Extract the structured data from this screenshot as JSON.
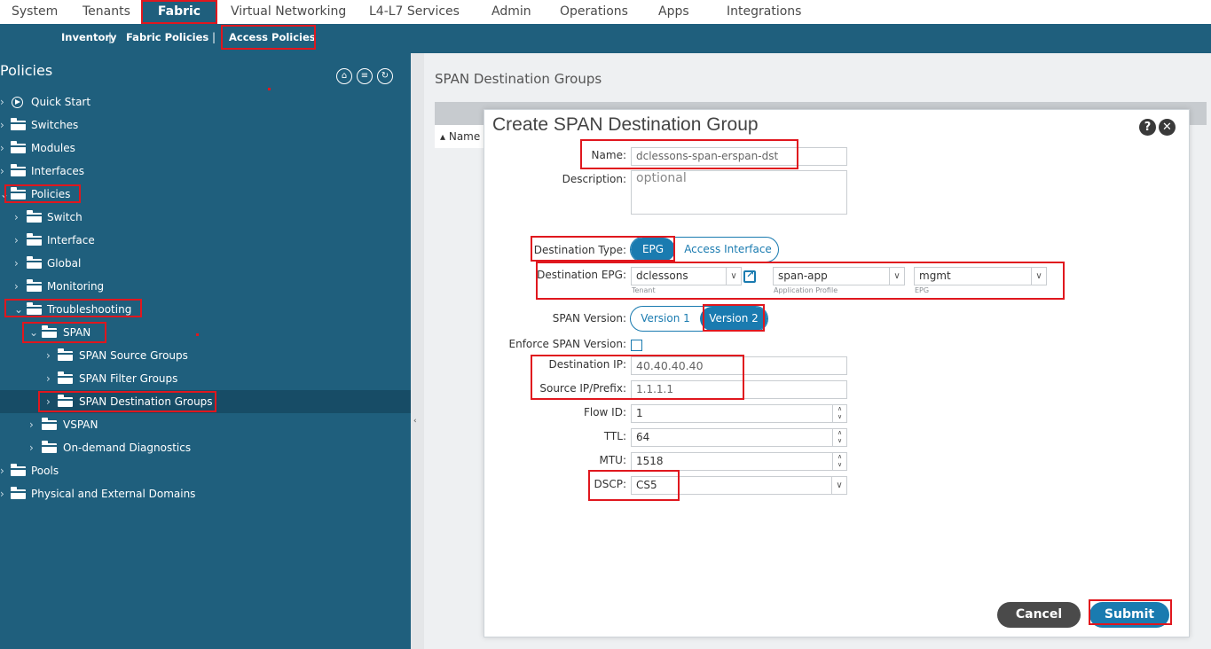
{
  "topnav": {
    "items": [
      "System",
      "Tenants",
      "Fabric",
      "Virtual Networking",
      "L4-L7 Services",
      "Admin",
      "Operations",
      "Apps",
      "Integrations"
    ],
    "active": "Fabric"
  },
  "subnav": {
    "items": [
      "Inventory",
      "Fabric Policies",
      "Access Policies"
    ],
    "separator": "|",
    "active": "Access Policies"
  },
  "sidebar": {
    "title": "Policies",
    "tool_icons": [
      "dashboard-icon",
      "collapse-all-icon",
      "refresh-icon"
    ],
    "tree": [
      {
        "label": "Quick Start",
        "icon": "quick-start-icon"
      },
      {
        "label": "Switches",
        "icon": "folder-icon"
      },
      {
        "label": "Modules",
        "icon": "folder-icon"
      },
      {
        "label": "Interfaces",
        "icon": "folder-icon"
      },
      {
        "label": "Policies",
        "icon": "folder-icon",
        "expanded": true
      },
      {
        "label": "Switch",
        "icon": "folder-icon"
      },
      {
        "label": "Interface",
        "icon": "folder-icon"
      },
      {
        "label": "Global",
        "icon": "folder-icon"
      },
      {
        "label": "Monitoring",
        "icon": "folder-icon"
      },
      {
        "label": "Troubleshooting",
        "icon": "folder-icon",
        "expanded": true
      },
      {
        "label": "SPAN",
        "icon": "folder-icon",
        "expanded": true
      },
      {
        "label": "SPAN Source Groups",
        "icon": "folder-icon"
      },
      {
        "label": "SPAN Filter Groups",
        "icon": "folder-icon"
      },
      {
        "label": "SPAN Destination Groups",
        "icon": "folder-icon",
        "selected": true
      },
      {
        "label": "VSPAN",
        "icon": "folder-icon"
      },
      {
        "label": "On-demand Diagnostics",
        "icon": "folder-icon"
      },
      {
        "label": "Pools",
        "icon": "folder-icon"
      },
      {
        "label": "Physical and External Domains",
        "icon": "folder-icon"
      }
    ]
  },
  "main": {
    "title": "SPAN Destination Groups",
    "column_header": "▴ Name"
  },
  "modal": {
    "title": "Create SPAN Destination Group",
    "name": {
      "label": "Name:",
      "value": "dclessons-span-erspan-dst"
    },
    "description": {
      "label": "Description:",
      "placeholder": "optional"
    },
    "destination_type": {
      "label": "Destination Type:",
      "options": [
        "EPG",
        "Access Interface"
      ],
      "selected": "EPG"
    },
    "destination_epg": {
      "label": "Destination EPG:",
      "tenant": {
        "value": "dclessons",
        "sublabel": "Tenant"
      },
      "app_profile": {
        "value": "span-app",
        "sublabel": "Application Profile"
      },
      "epg": {
        "value": "mgmt",
        "sublabel": "EPG"
      }
    },
    "span_version": {
      "label": "SPAN Version:",
      "options": [
        "Version 1",
        "Version 2"
      ],
      "selected": "Version 2"
    },
    "enforce_span_version": {
      "label": "Enforce SPAN Version:",
      "checked": false
    },
    "destination_ip": {
      "label": "Destination IP:",
      "value": "40.40.40.40"
    },
    "source_ip": {
      "label": "Source IP/Prefix:",
      "value": "1.1.1.1"
    },
    "flow_id": {
      "label": "Flow ID:",
      "value": "1"
    },
    "ttl": {
      "label": "TTL:",
      "value": "64"
    },
    "mtu": {
      "label": "MTU:",
      "value": "1518"
    },
    "dscp": {
      "label": "DSCP:",
      "value": "CS5"
    },
    "cancel_label": "Cancel",
    "submit_label": "Submit"
  },
  "colors": {
    "nav_bg": "#1f5f7d",
    "accent": "#1a7bb0",
    "highlight": "#e0171e",
    "cancel_bg": "#4a4a4a"
  }
}
